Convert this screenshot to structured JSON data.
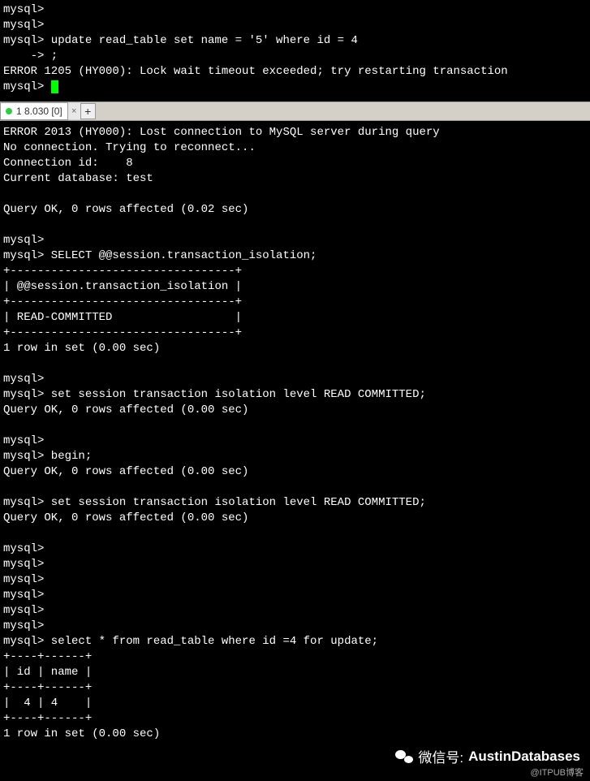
{
  "top_terminal": {
    "lines": [
      "mysql>",
      "mysql>",
      "mysql> update read_table set name = '5' where id = 4",
      "    -> ;",
      "ERROR 1205 (HY000): Lock wait timeout exceeded; try restarting transaction",
      "mysql> "
    ]
  },
  "tab": {
    "label": "1 8.030 [0]",
    "close": "×",
    "add": "+"
  },
  "bottom_terminal": {
    "lines": [
      "ERROR 2013 (HY000): Lost connection to MySQL server during query",
      "No connection. Trying to reconnect...",
      "Connection id:    8",
      "Current database: test",
      "",
      "Query OK, 0 rows affected (0.02 sec)",
      "",
      "mysql>",
      "mysql> SELECT @@session.transaction_isolation;",
      "+---------------------------------+",
      "| @@session.transaction_isolation |",
      "+---------------------------------+",
      "| READ-COMMITTED                  |",
      "+---------------------------------+",
      "1 row in set (0.00 sec)",
      "",
      "mysql>",
      "mysql> set session transaction isolation level READ COMMITTED;",
      "Query OK, 0 rows affected (0.00 sec)",
      "",
      "mysql>",
      "mysql> begin;",
      "Query OK, 0 rows affected (0.00 sec)",
      "",
      "mysql> set session transaction isolation level READ COMMITTED;",
      "Query OK, 0 rows affected (0.00 sec)",
      "",
      "mysql>",
      "mysql>",
      "mysql>",
      "mysql>",
      "mysql>",
      "mysql>",
      "mysql> select * from read_table where id =4 for update;",
      "+----+------+",
      "| id | name |",
      "+----+------+",
      "|  4 | 4    |",
      "+----+------+",
      "1 row in set (0.00 sec)",
      ""
    ]
  },
  "chart_data": {
    "type": "table",
    "title": "@@session.transaction_isolation",
    "columns": [
      "@@session.transaction_isolation"
    ],
    "rows": [
      [
        "READ-COMMITTED"
      ]
    ]
  },
  "chart_data_2": {
    "type": "table",
    "title": "read_table where id=4",
    "columns": [
      "id",
      "name"
    ],
    "rows": [
      [
        4,
        "4"
      ]
    ]
  },
  "watermark": {
    "prefix": "微信号:",
    "name": "AustinDatabases",
    "sub": "@ITPUB博客"
  }
}
